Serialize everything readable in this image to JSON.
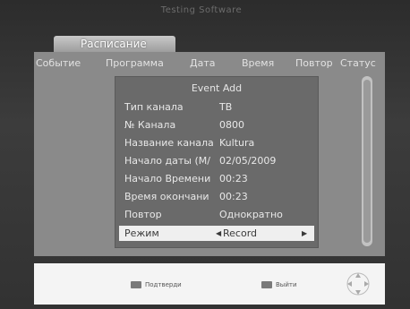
{
  "watermark": "Testing Software",
  "tab": {
    "label": "Расписание"
  },
  "columns": [
    "Событие",
    "Программа",
    "Дата",
    "Время",
    "Повтор",
    "Статус"
  ],
  "dialog": {
    "title": "Event Add",
    "rows": [
      {
        "label": "Тип канала",
        "value": "ТВ"
      },
      {
        "label": "№ Канала",
        "value": "0800"
      },
      {
        "label": "Название канала",
        "value": "Kultura"
      },
      {
        "label": "Начало даты (М/",
        "value": "02/05/2009"
      },
      {
        "label": "Начало Времени",
        "value": "00:23"
      },
      {
        "label": " Время окончани",
        "value": "00:23"
      },
      {
        "label": "Повтор",
        "value": "Однократно"
      },
      {
        "label": "Режим",
        "value": "Record"
      }
    ]
  },
  "footer": {
    "confirm_label": "Подтверди",
    "exit_label": "Выйти"
  },
  "colors": {
    "panel": "#8a8a8a",
    "dialog": "#6a6a6a",
    "selected_row": "#efefef",
    "footer": "#f4f4f4"
  }
}
